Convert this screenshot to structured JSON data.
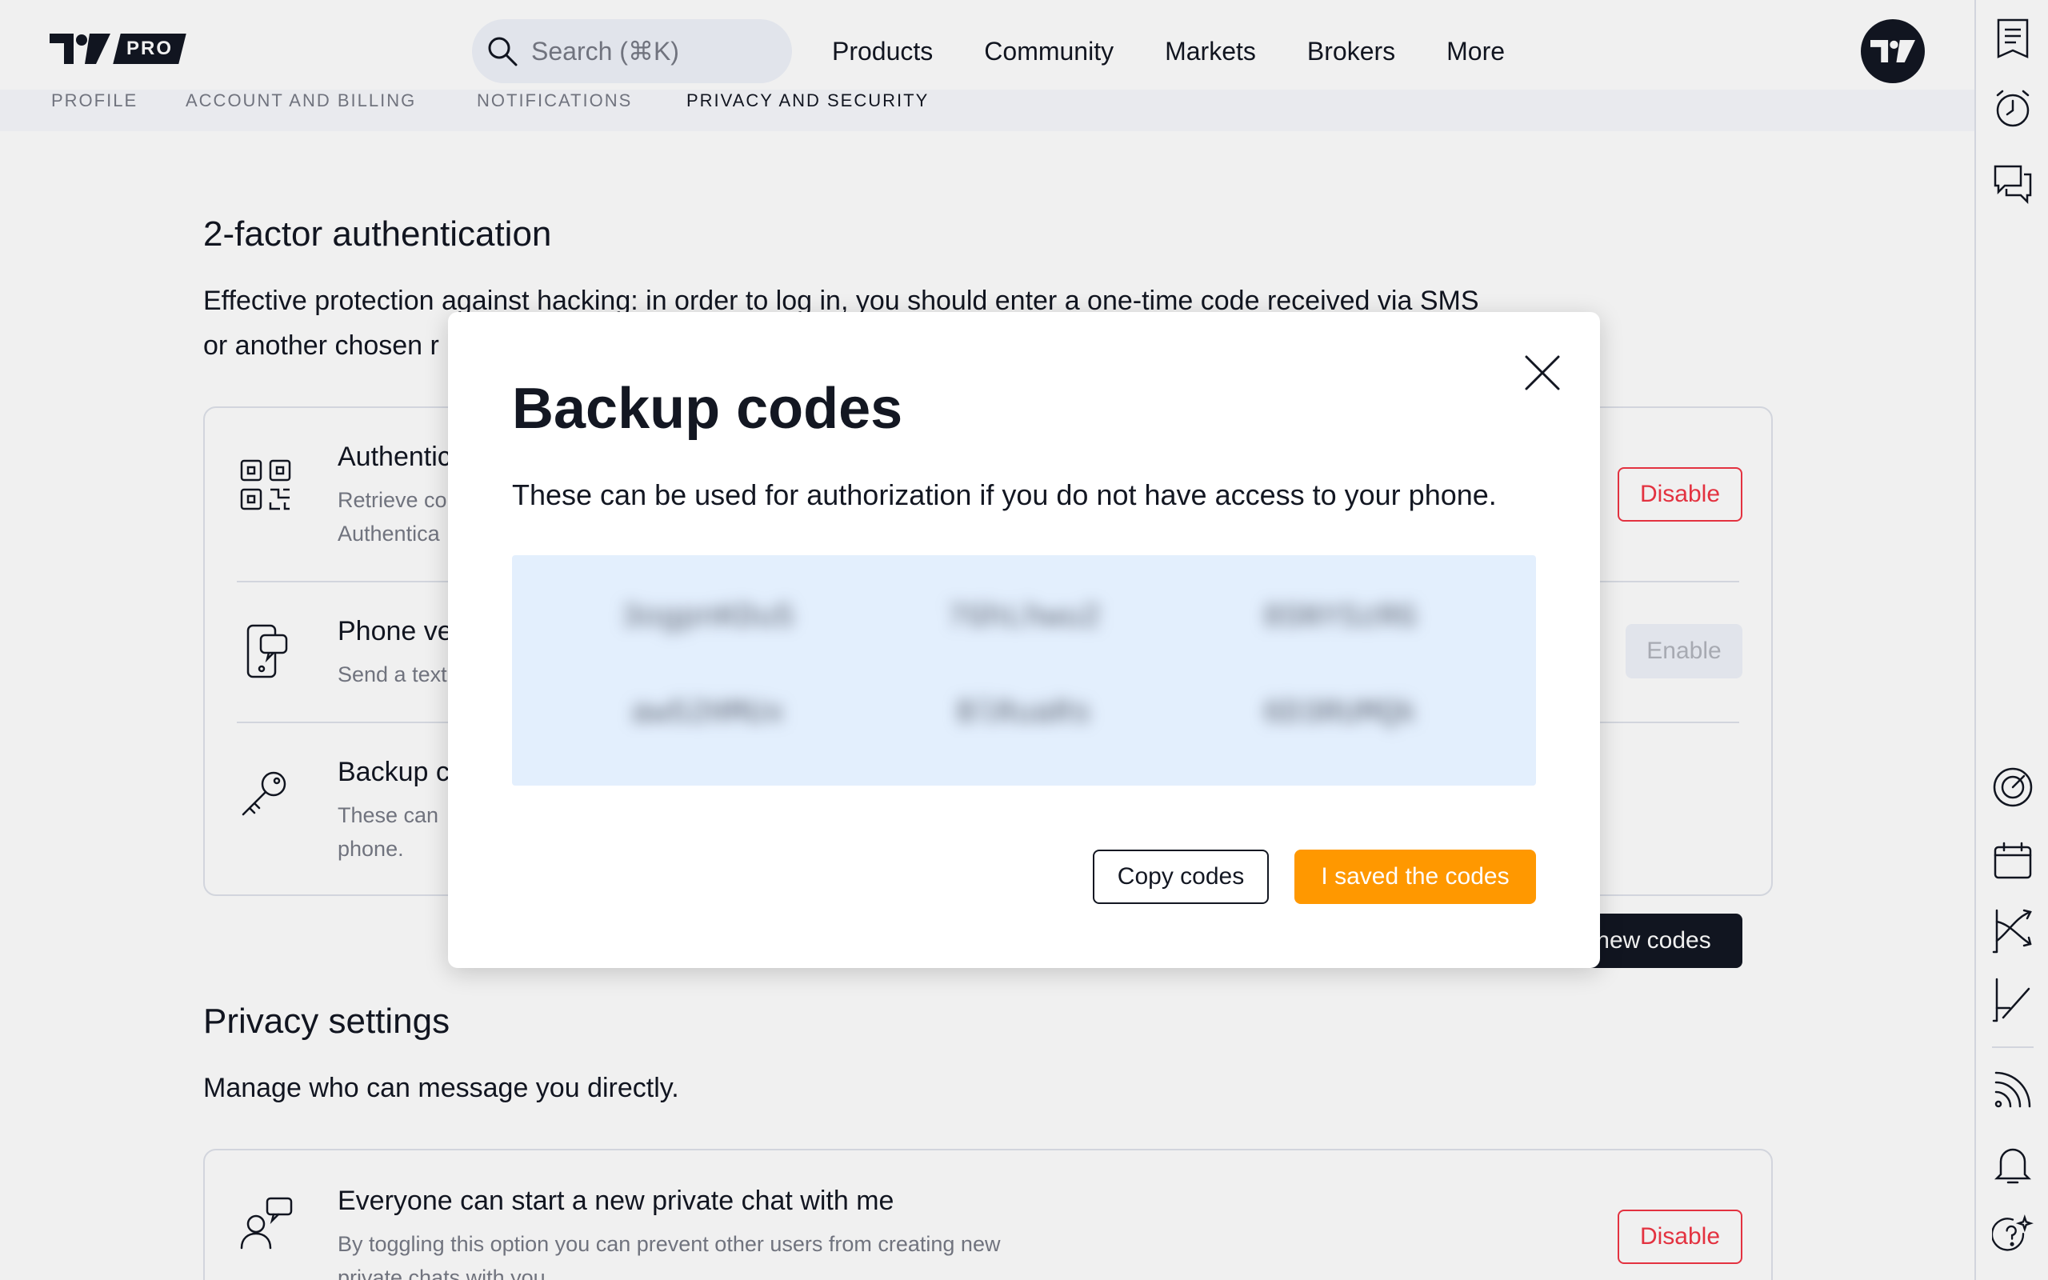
{
  "header": {
    "logo_badge": "PRO",
    "search_placeholder": "Search (⌘K)",
    "nav": [
      "Products",
      "Community",
      "Markets",
      "Brokers",
      "More"
    ]
  },
  "subtabs": [
    "Profile",
    "Account and billing",
    "Notifications",
    "Privacy and security"
  ],
  "twofa": {
    "title": "2-factor authentication",
    "description_line1": "Effective protection against hacking: in order to log in, you should enter a one-time code received via SMS",
    "description_line2": "or another chosen r",
    "rows": [
      {
        "title": "Authentic",
        "desc_line1": "Retrieve co",
        "desc_line2": "Authentica",
        "button": "Disable"
      },
      {
        "title": "Phone ve",
        "desc_line1": "Send a text",
        "button": "Enable"
      },
      {
        "title": "Backup c",
        "desc_line1": "These can",
        "desc_line2": "phone.",
        "button": "new codes"
      }
    ]
  },
  "privacy": {
    "title": "Privacy settings",
    "description": "Manage who can message you directly.",
    "row": {
      "title": "Everyone can start a new private chat with me",
      "desc_line1": "By toggling this option you can prevent other users from creating new",
      "desc_line2": "private chats with you.",
      "button": "Disable"
    }
  },
  "modal": {
    "title": "Backup codes",
    "text": "These can be used for authorization if you do not have access to your phone.",
    "codes": [
      "3ogpnKDu5",
      "7GhLhwu2",
      "8SNYSzRG",
      "aw52HMUx",
      "BlRuaRs",
      "6D3RUMQk"
    ],
    "copy_button": "Copy codes",
    "saved_button": "I saved the codes"
  },
  "colors": {
    "accent_orange": "#ff9800",
    "danger_red": "#f23645",
    "codes_bg": "#e3effd"
  }
}
